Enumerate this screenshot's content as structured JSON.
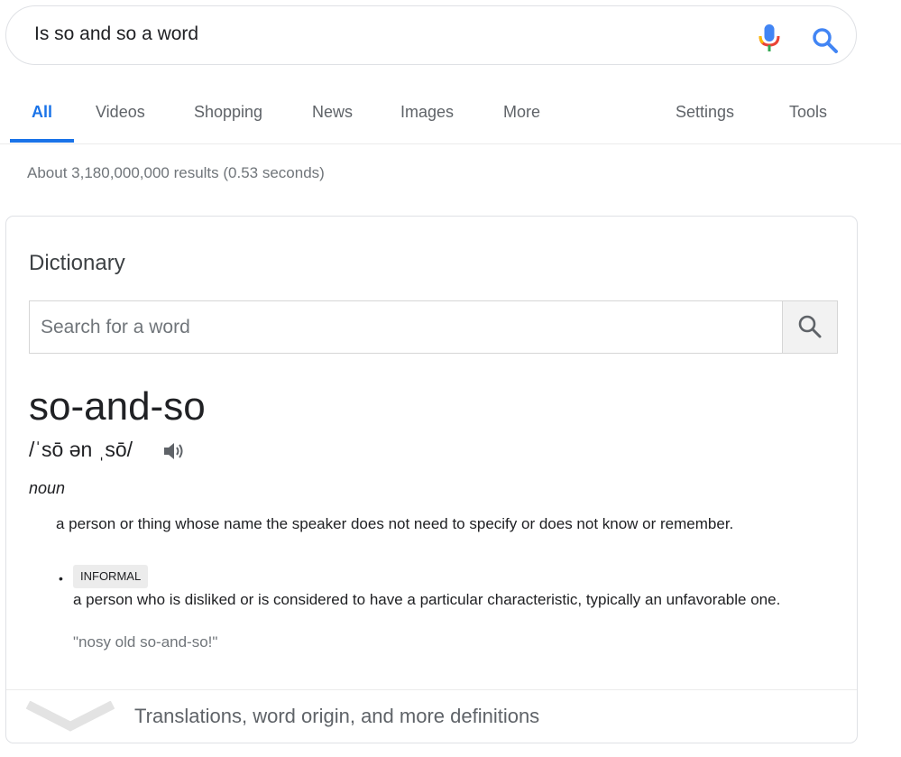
{
  "search": {
    "query": "Is so and so a word"
  },
  "tabs": [
    {
      "label": "All",
      "active": true
    },
    {
      "label": "Videos"
    },
    {
      "label": "Shopping"
    },
    {
      "label": "News"
    },
    {
      "label": "Images"
    },
    {
      "label": "More"
    },
    {
      "label": "Settings"
    },
    {
      "label": "Tools"
    }
  ],
  "result_stats": "About 3,180,000,000 results (0.53 seconds)",
  "dictionary": {
    "title": "Dictionary",
    "search_placeholder": "Search for a word",
    "headword": "so-and-so",
    "pronunciation": "/ˈsō ən ˌsō/",
    "part_of_speech": "noun",
    "definitions": [
      {
        "text": "a person or thing whose name the speaker does not need to specify or does not know or remember."
      },
      {
        "label": "INFORMAL",
        "text": "a person who is disliked or is considered to have a particular characteristic, typically an unfavorable one.",
        "example": "\"nosy old so-and-so!\""
      }
    ],
    "more_link": "Translations, word origin, and more definitions"
  },
  "colors": {
    "accent": "#1a73e8",
    "mic_blue": "#4285f4",
    "mic_red": "#ea4335",
    "mic_yellow": "#fbbc04",
    "mic_green": "#34a853"
  },
  "icons": [
    "mic-icon",
    "search-icon",
    "speaker-icon",
    "chevron-down-icon"
  ]
}
